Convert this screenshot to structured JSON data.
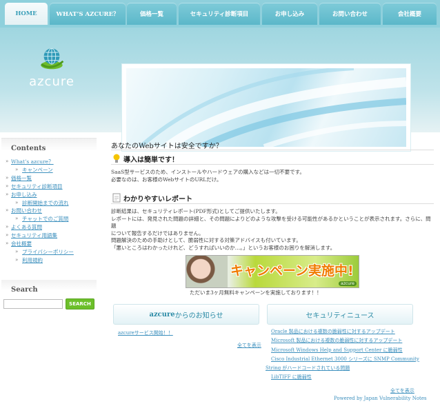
{
  "nav": {
    "tabs": [
      {
        "label": "HOME",
        "active": true
      },
      {
        "label": "WHAT’S AZCURE？"
      },
      {
        "label": "価格一覧"
      },
      {
        "label": "セキュリティ診断項目"
      },
      {
        "label": "お申し込み"
      },
      {
        "label": "お問い合わせ"
      },
      {
        "label": "会社概要"
      }
    ]
  },
  "header": {
    "logo_text": "azcure"
  },
  "sidebar": {
    "contents_title": "Contents",
    "menu": [
      {
        "label": "What’s azcure？",
        "sub": false
      },
      {
        "label": "キャンペーン",
        "sub": true
      },
      {
        "label": "価格一覧",
        "sub": false
      },
      {
        "label": "セキュリティ診断項目",
        "sub": false
      },
      {
        "label": "お申し込み",
        "sub": false
      },
      {
        "label": "診断開始までの流れ",
        "sub": true
      },
      {
        "label": "お問い合わせ",
        "sub": false
      },
      {
        "label": "チャットでのご質問",
        "sub": true
      },
      {
        "label": "よくある質問",
        "sub": false
      },
      {
        "label": "セキュリティ用語集",
        "sub": false
      },
      {
        "label": "会社概要",
        "sub": false
      },
      {
        "label": "プライバシーポリシー",
        "sub": true
      },
      {
        "label": "利用規約",
        "sub": true
      }
    ],
    "search_title": "Search",
    "search_placeholder": "",
    "search_button": "SEARCH"
  },
  "main": {
    "title": "あなたのWebサイトは安全ですか？",
    "section1": {
      "heading": "導入は簡単です！",
      "lines": [
        "SaaS型サービスのため、インストールやハードウェアの購入などは一切不要です。",
        "必要なのは、お客様のWebサイトのURLだけ。"
      ]
    },
    "section2": {
      "heading": "わかりやすいレポート",
      "lines": [
        "診断結果は、セキュリティレポート(PDF形式)としてご提供いたします。",
        "レポートには、発見された問題の詳細と、その問題によりどのような攻撃を受ける可能性があるかということが表示されます。さらに、問題",
        "について報告するだけではありません。",
        "問題解決のための手助けとして、脆弱性に対する対策アドバイスも付いています。",
        "「悪いところはわかったけれど、どうすればいいのか…。」というお客様のお困りを解消します。"
      ]
    },
    "campaign": {
      "banner_text": "キャンペーン実施中!",
      "brand": "azcure",
      "caption": "ただいま3ヶ月無料キャンペーンを実施しております！！"
    },
    "news": {
      "title_brand": "azcure",
      "title_rest": "からのお知らせ",
      "items": [
        "azcureサービス開始！！"
      ],
      "more": "全てを表示"
    },
    "security_news": {
      "title": "セキュリティニュース",
      "items": [
        "Oracle 製品における複数の脆弱性に対するアップデート",
        "Microsoft 製品における複数の脆弱性に対するアップデート",
        "Microsoft Windows Help and Support Center に脆弱性",
        "Cisco Industrial Ethernet 3000 シリーズに SNMP Community",
        "String がハードコードされている問題",
        "LibTIFF に脆弱性"
      ],
      "more": "全てを表示",
      "powered": "Powered by Japan Vulnerability Notes"
    }
  }
}
